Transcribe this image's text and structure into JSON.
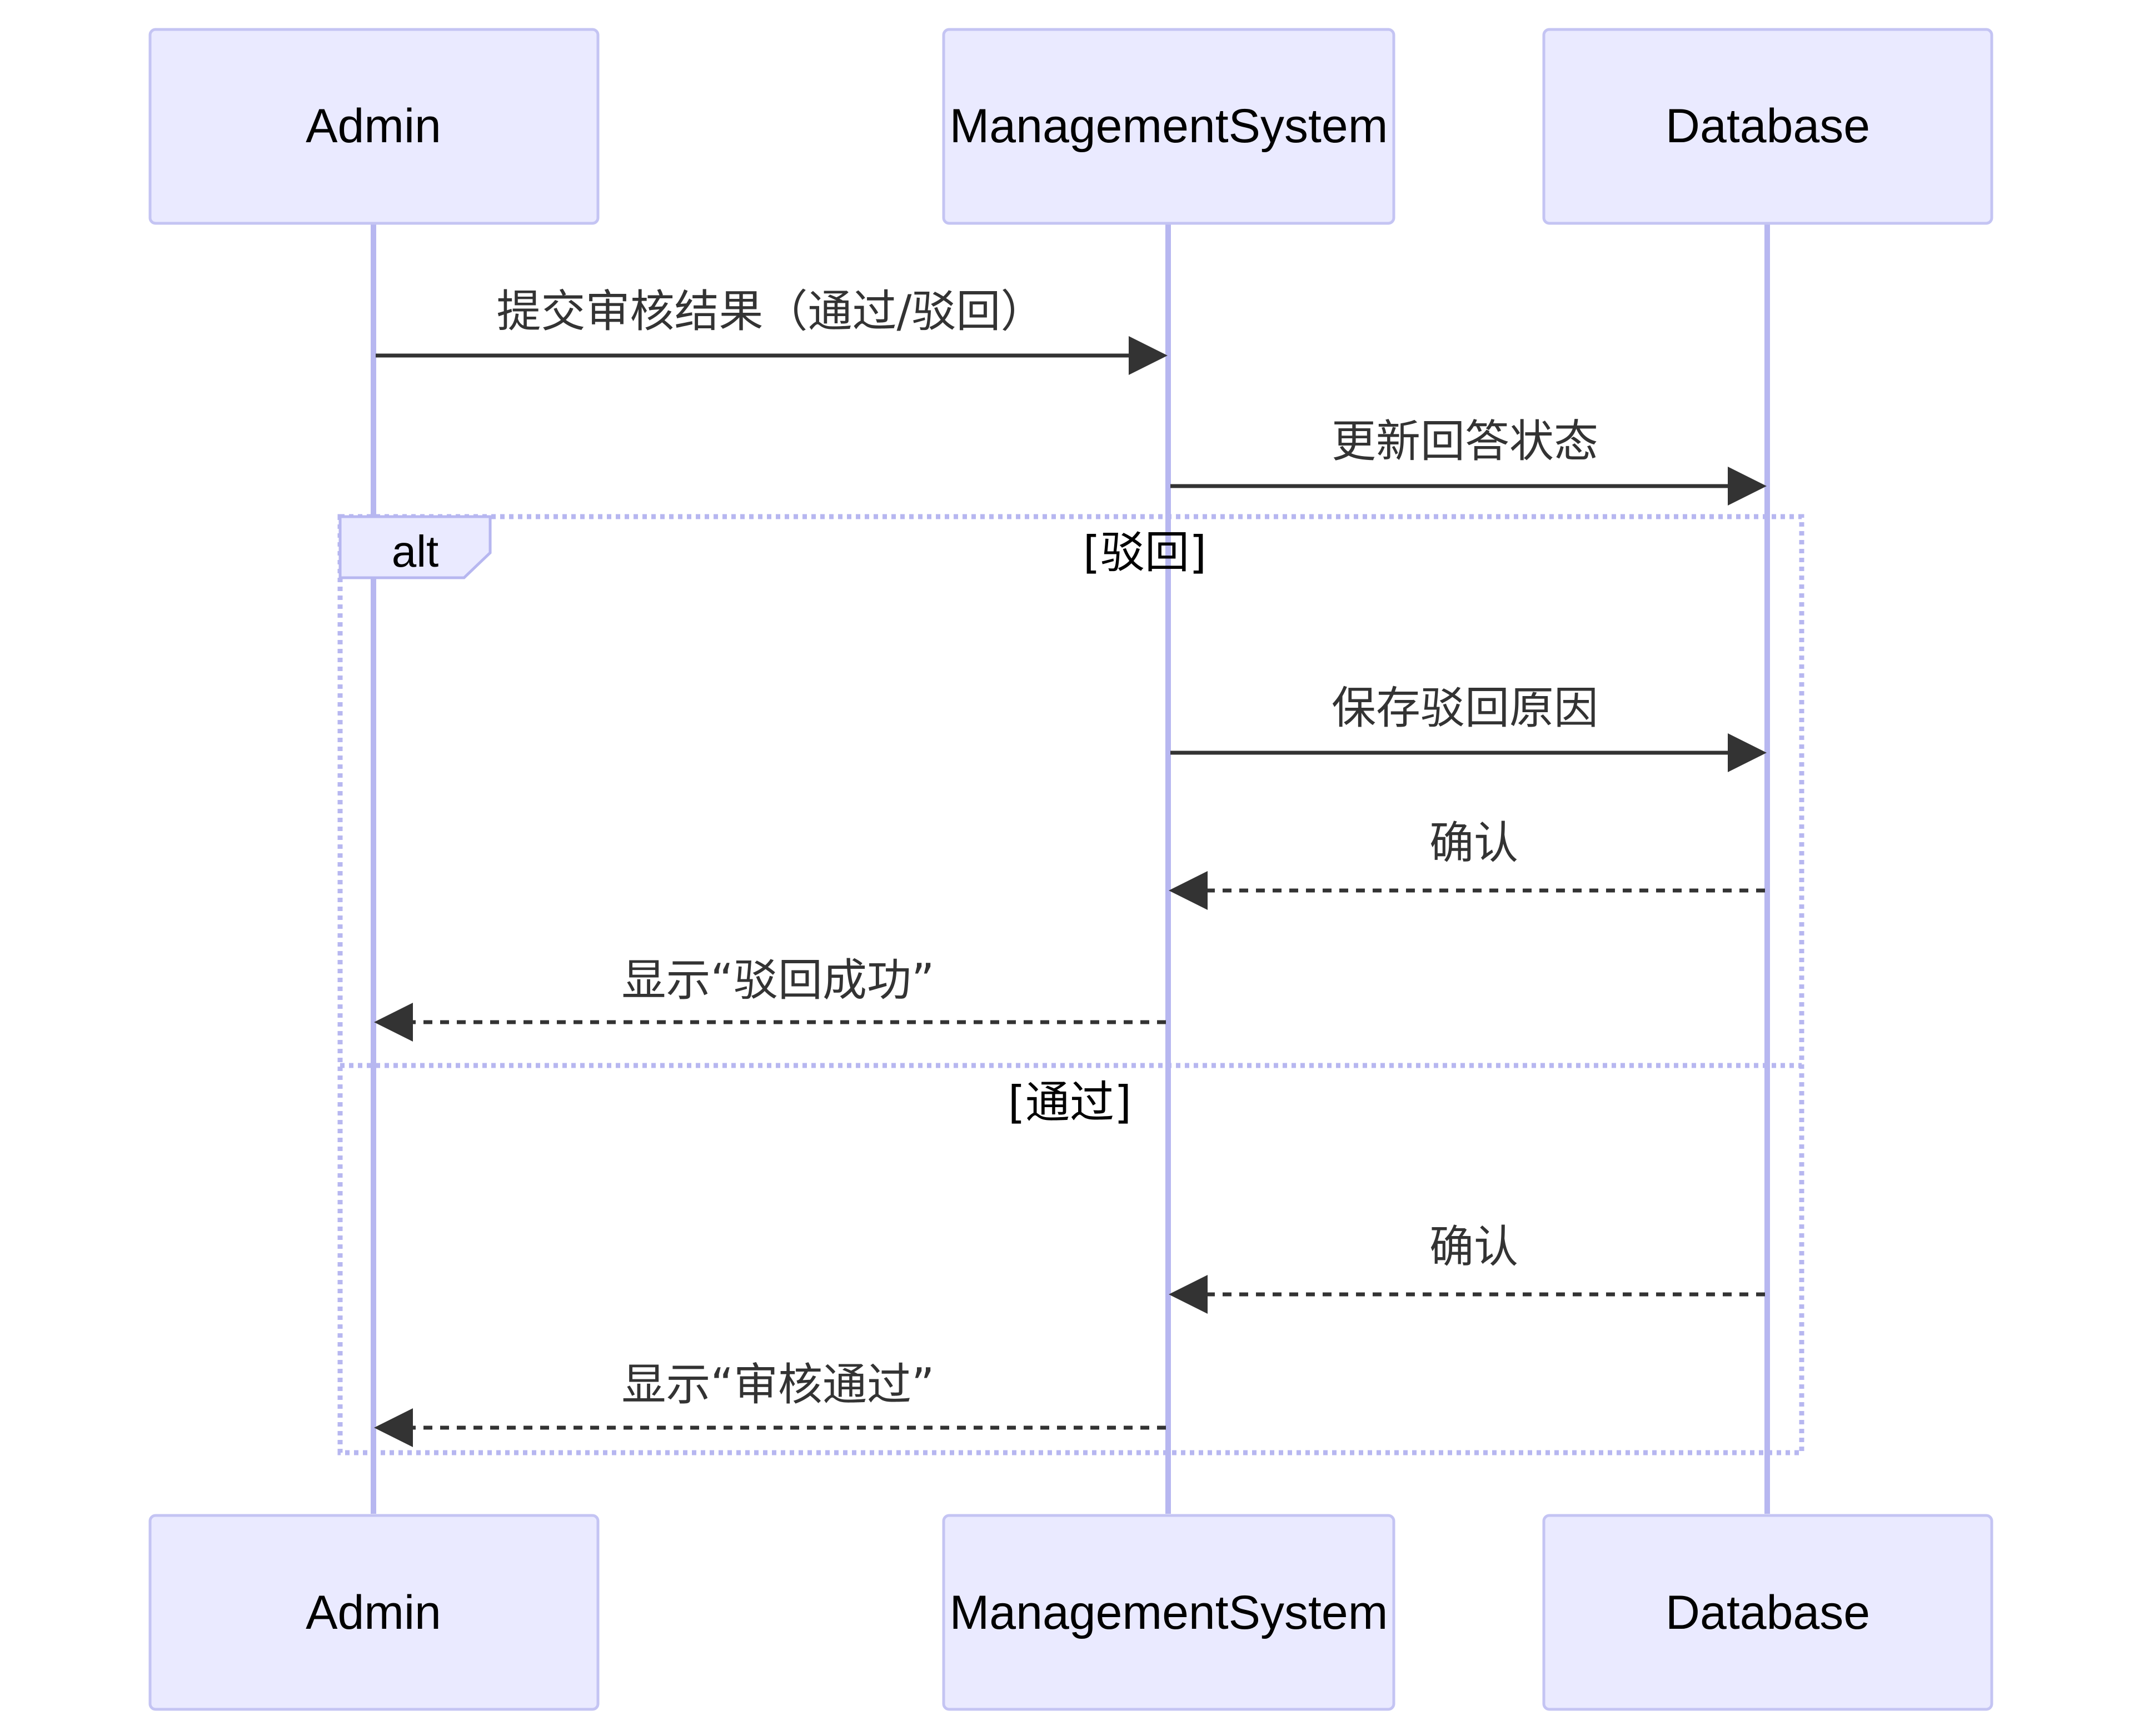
{
  "actors": [
    {
      "id": "admin",
      "label": "Admin"
    },
    {
      "id": "system",
      "label": "ManagementSystem"
    },
    {
      "id": "db",
      "label": "Database"
    }
  ],
  "messages": [
    {
      "from": "admin",
      "to": "system",
      "label": "提交审核结果（通过/驳回）",
      "style": "solid"
    },
    {
      "from": "system",
      "to": "db",
      "label": "更新回答状态",
      "style": "solid"
    },
    {
      "from": "system",
      "to": "db",
      "label": "保存驳回原因",
      "style": "solid"
    },
    {
      "from": "db",
      "to": "system",
      "label": "确认",
      "style": "dashed"
    },
    {
      "from": "system",
      "to": "admin",
      "label": "显示“驳回成功”",
      "style": "dashed"
    },
    {
      "from": "db",
      "to": "system",
      "label": "确认",
      "style": "dashed"
    },
    {
      "from": "system",
      "to": "admin",
      "label": "显示“审核通过”",
      "style": "dashed"
    }
  ],
  "alt_frame": {
    "label": "alt",
    "conditions": [
      "[驳回]",
      "[通过]"
    ]
  },
  "colors": {
    "actor_fill": "#eaeaff",
    "actor_stroke": "#c4c4f3",
    "lifeline": "#b7b7f0",
    "message": "#333333"
  }
}
